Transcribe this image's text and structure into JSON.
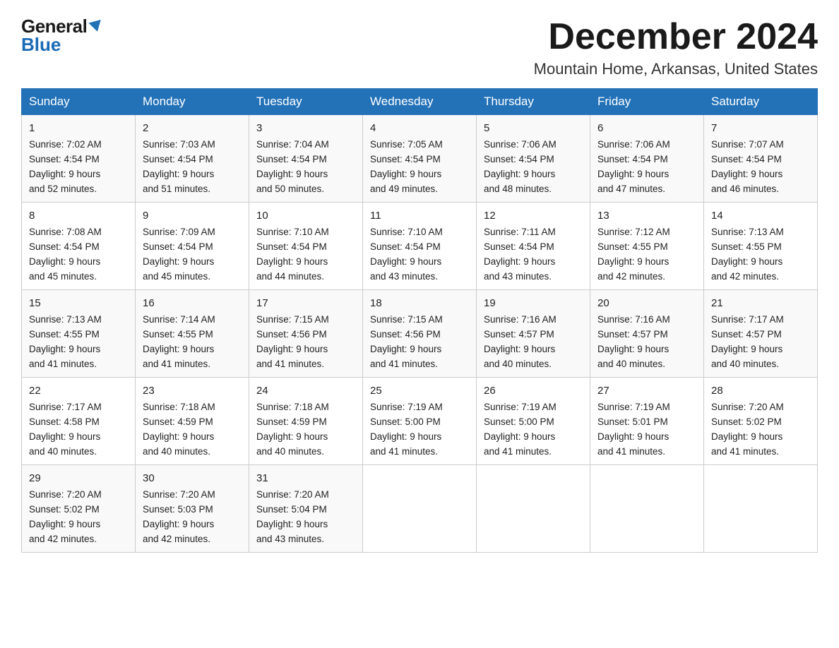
{
  "logo": {
    "general": "General",
    "blue": "Blue",
    "triangle": "▲"
  },
  "header": {
    "month_year": "December 2024",
    "location": "Mountain Home, Arkansas, United States"
  },
  "days_of_week": [
    "Sunday",
    "Monday",
    "Tuesday",
    "Wednesday",
    "Thursday",
    "Friday",
    "Saturday"
  ],
  "weeks": [
    [
      {
        "day": "1",
        "sunrise": "7:02 AM",
        "sunset": "4:54 PM",
        "daylight": "9 hours and 52 minutes."
      },
      {
        "day": "2",
        "sunrise": "7:03 AM",
        "sunset": "4:54 PM",
        "daylight": "9 hours and 51 minutes."
      },
      {
        "day": "3",
        "sunrise": "7:04 AM",
        "sunset": "4:54 PM",
        "daylight": "9 hours and 50 minutes."
      },
      {
        "day": "4",
        "sunrise": "7:05 AM",
        "sunset": "4:54 PM",
        "daylight": "9 hours and 49 minutes."
      },
      {
        "day": "5",
        "sunrise": "7:06 AM",
        "sunset": "4:54 PM",
        "daylight": "9 hours and 48 minutes."
      },
      {
        "day": "6",
        "sunrise": "7:06 AM",
        "sunset": "4:54 PM",
        "daylight": "9 hours and 47 minutes."
      },
      {
        "day": "7",
        "sunrise": "7:07 AM",
        "sunset": "4:54 PM",
        "daylight": "9 hours and 46 minutes."
      }
    ],
    [
      {
        "day": "8",
        "sunrise": "7:08 AM",
        "sunset": "4:54 PM",
        "daylight": "9 hours and 45 minutes."
      },
      {
        "day": "9",
        "sunrise": "7:09 AM",
        "sunset": "4:54 PM",
        "daylight": "9 hours and 45 minutes."
      },
      {
        "day": "10",
        "sunrise": "7:10 AM",
        "sunset": "4:54 PM",
        "daylight": "9 hours and 44 minutes."
      },
      {
        "day": "11",
        "sunrise": "7:10 AM",
        "sunset": "4:54 PM",
        "daylight": "9 hours and 43 minutes."
      },
      {
        "day": "12",
        "sunrise": "7:11 AM",
        "sunset": "4:54 PM",
        "daylight": "9 hours and 43 minutes."
      },
      {
        "day": "13",
        "sunrise": "7:12 AM",
        "sunset": "4:55 PM",
        "daylight": "9 hours and 42 minutes."
      },
      {
        "day": "14",
        "sunrise": "7:13 AM",
        "sunset": "4:55 PM",
        "daylight": "9 hours and 42 minutes."
      }
    ],
    [
      {
        "day": "15",
        "sunrise": "7:13 AM",
        "sunset": "4:55 PM",
        "daylight": "9 hours and 41 minutes."
      },
      {
        "day": "16",
        "sunrise": "7:14 AM",
        "sunset": "4:55 PM",
        "daylight": "9 hours and 41 minutes."
      },
      {
        "day": "17",
        "sunrise": "7:15 AM",
        "sunset": "4:56 PM",
        "daylight": "9 hours and 41 minutes."
      },
      {
        "day": "18",
        "sunrise": "7:15 AM",
        "sunset": "4:56 PM",
        "daylight": "9 hours and 41 minutes."
      },
      {
        "day": "19",
        "sunrise": "7:16 AM",
        "sunset": "4:57 PM",
        "daylight": "9 hours and 40 minutes."
      },
      {
        "day": "20",
        "sunrise": "7:16 AM",
        "sunset": "4:57 PM",
        "daylight": "9 hours and 40 minutes."
      },
      {
        "day": "21",
        "sunrise": "7:17 AM",
        "sunset": "4:57 PM",
        "daylight": "9 hours and 40 minutes."
      }
    ],
    [
      {
        "day": "22",
        "sunrise": "7:17 AM",
        "sunset": "4:58 PM",
        "daylight": "9 hours and 40 minutes."
      },
      {
        "day": "23",
        "sunrise": "7:18 AM",
        "sunset": "4:59 PM",
        "daylight": "9 hours and 40 minutes."
      },
      {
        "day": "24",
        "sunrise": "7:18 AM",
        "sunset": "4:59 PM",
        "daylight": "9 hours and 40 minutes."
      },
      {
        "day": "25",
        "sunrise": "7:19 AM",
        "sunset": "5:00 PM",
        "daylight": "9 hours and 41 minutes."
      },
      {
        "day": "26",
        "sunrise": "7:19 AM",
        "sunset": "5:00 PM",
        "daylight": "9 hours and 41 minutes."
      },
      {
        "day": "27",
        "sunrise": "7:19 AM",
        "sunset": "5:01 PM",
        "daylight": "9 hours and 41 minutes."
      },
      {
        "day": "28",
        "sunrise": "7:20 AM",
        "sunset": "5:02 PM",
        "daylight": "9 hours and 41 minutes."
      }
    ],
    [
      {
        "day": "29",
        "sunrise": "7:20 AM",
        "sunset": "5:02 PM",
        "daylight": "9 hours and 42 minutes."
      },
      {
        "day": "30",
        "sunrise": "7:20 AM",
        "sunset": "5:03 PM",
        "daylight": "9 hours and 42 minutes."
      },
      {
        "day": "31",
        "sunrise": "7:20 AM",
        "sunset": "5:04 PM",
        "daylight": "9 hours and 43 minutes."
      },
      null,
      null,
      null,
      null
    ]
  ],
  "labels": {
    "sunrise": "Sunrise:",
    "sunset": "Sunset:",
    "daylight": "Daylight:"
  }
}
